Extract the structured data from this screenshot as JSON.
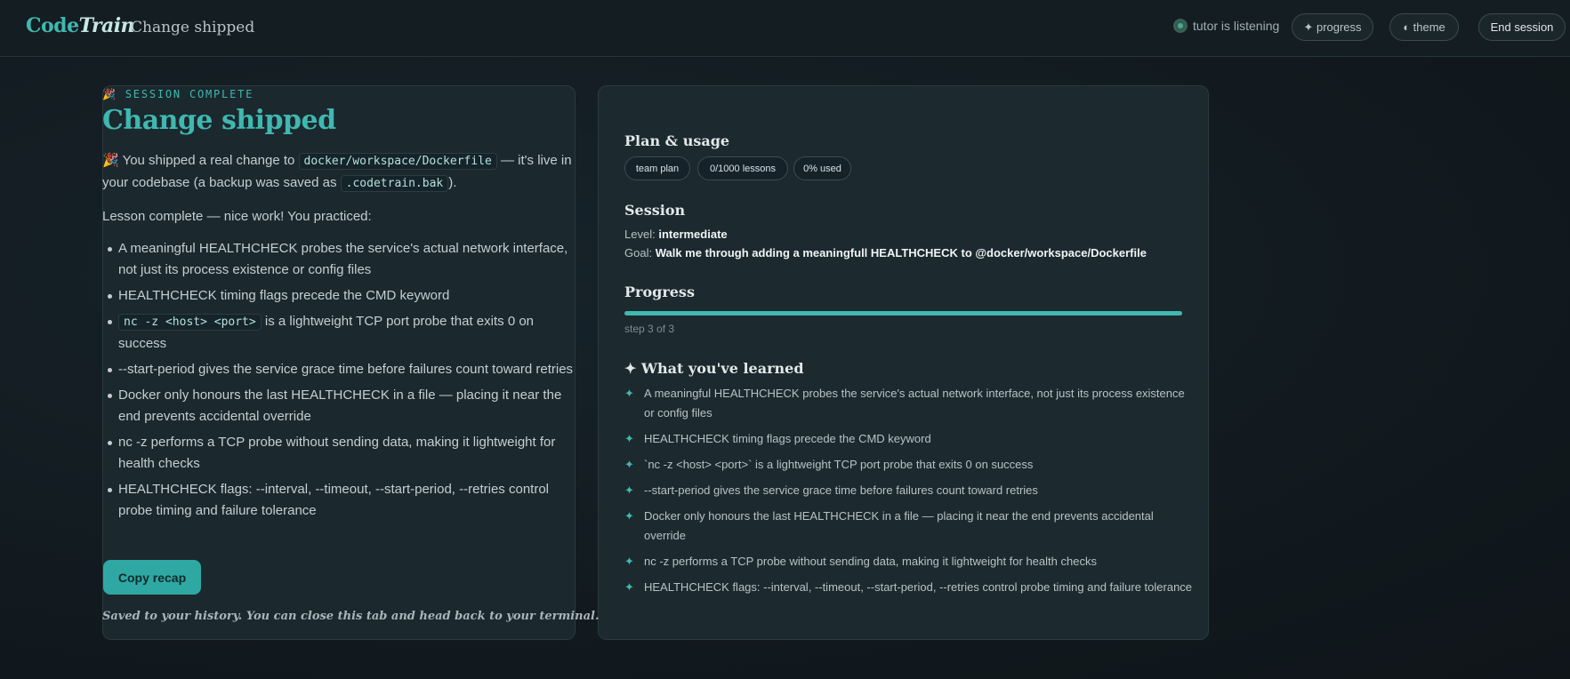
{
  "header": {
    "brand_code": "Code",
    "brand_train": "Train",
    "title": "Change shipped",
    "status": "tutor is listening",
    "progress_btn": "✦ progress",
    "theme_btn": "◐ theme",
    "end_btn": "End session"
  },
  "left": {
    "eyebrow": "🎉 SESSION COMPLETE",
    "heading": "Change shipped",
    "shipped_pre": "🎉 You shipped a real change to ",
    "shipped_file": "docker/workspace/Dockerfile",
    "shipped_mid": " — it's live in your codebase (a backup was saved as ",
    "shipped_backup": ".codetrain.bak",
    "shipped_post": ").",
    "practiced": "Lesson complete — nice work! You practiced:",
    "bullets": [
      "A meaningful HEALTHCHECK probes the service's actual network interface, not just its process existence or config files",
      "HEALTHCHECK timing flags precede the CMD keyword",
      "is a lightweight TCP port probe that exits 0 on success",
      "--start-period gives the service grace time before failures count toward retries",
      "Docker only honours the last HEALTHCHECK in a file — placing it near the end prevents accidental override",
      "nc -z performs a TCP probe without sending data, making it lightweight for health checks",
      "HEALTHCHECK flags: --interval, --timeout, --start-period, --retries control probe timing and failure tolerance"
    ],
    "bullet3_code": "nc -z <host> <port>",
    "copy_btn": "Copy recap",
    "saved": "Saved to your history. You can close this tab and head back to your terminal."
  },
  "right": {
    "plan_heading": "Plan & usage",
    "chips": [
      "team plan",
      "0/1000 lessons",
      "0% used"
    ],
    "session_heading": "Session",
    "level_label": "Level:",
    "level_value": "intermediate",
    "goal_label": "Goal:",
    "goal_value": "Walk me through adding a meaningfull HEALTHCHECK to @docker/workspace/Dockerfile",
    "progress_heading": "Progress",
    "progress_fraction": 1.0,
    "step_text": "step 3 of 3",
    "learned_heading": "✦ What you've learned",
    "learned": [
      "A meaningful HEALTHCHECK probes the service's actual network interface, not just its process existence or config files",
      "HEALTHCHECK timing flags precede the CMD keyword",
      "`nc -z <host> <port>` is a lightweight TCP port probe that exits 0 on success",
      "--start-period gives the service grace time before failures count toward retries",
      "Docker only honours the last HEALTHCHECK in a file — placing it near the end prevents accidental override",
      "nc -z performs a TCP probe without sending data, making it lightweight for health checks",
      "HEALTHCHECK flags: --interval, --timeout, --start-period, --retries control probe timing and failure tolerance"
    ]
  },
  "colors": {
    "accent": "#3fb8b0",
    "background": "#121a1f",
    "panel": "#1c292f"
  }
}
